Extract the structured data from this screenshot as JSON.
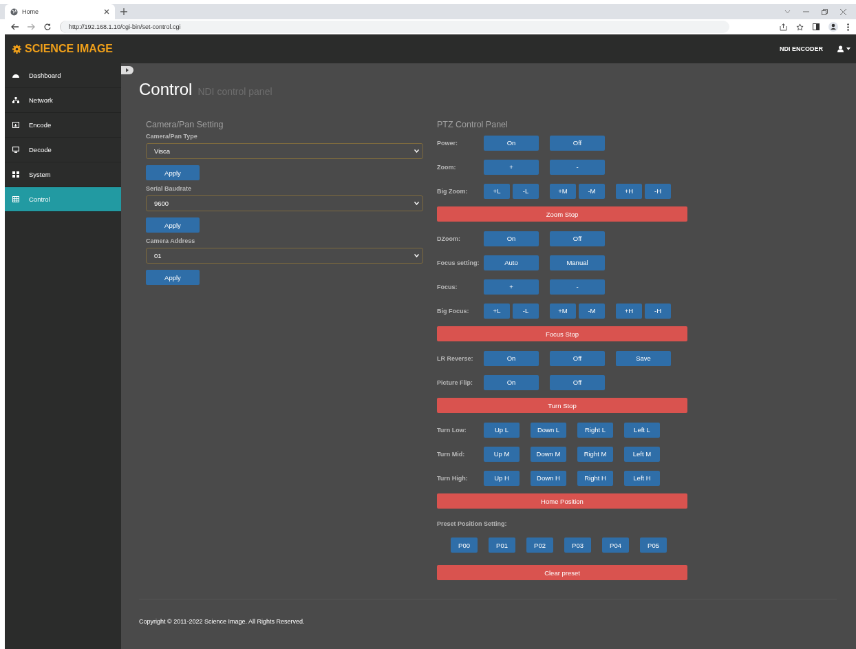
{
  "browser": {
    "tab_title": "Home",
    "url": "http://192.168.1.10/cgi-bin/set-control.cgi"
  },
  "header": {
    "brand": "SCIENCE IMAGE",
    "device": "NDI ENCODER"
  },
  "sidebar": {
    "items": [
      {
        "label": "Dashboard",
        "selected": false
      },
      {
        "label": "Network",
        "selected": false
      },
      {
        "label": "Encode",
        "selected": false
      },
      {
        "label": "Decode",
        "selected": false
      },
      {
        "label": "System",
        "selected": false
      },
      {
        "label": "Control",
        "selected": true
      }
    ]
  },
  "page": {
    "title": "Control",
    "subtitle": "NDI control panel"
  },
  "camera_settings": {
    "heading": "Camera/Pan Setting",
    "fields": [
      {
        "label": "Camera/Pan Type",
        "value": "Visca",
        "button": "Apply"
      },
      {
        "label": "Serial Baudrate",
        "value": "9600",
        "button": "Apply"
      },
      {
        "label": "Camera Address",
        "value": "01",
        "button": "Apply"
      }
    ]
  },
  "ptz": {
    "heading": "PTZ Control Panel",
    "rows": [
      {
        "kind": "row",
        "label": "Power:",
        "groups": [
          [
            "On"
          ],
          [
            "Off"
          ]
        ]
      },
      {
        "kind": "row",
        "label": "Zoom:",
        "groups": [
          [
            "+"
          ],
          [
            "-"
          ]
        ]
      },
      {
        "kind": "row",
        "label": "Big Zoom:",
        "groups": [
          [
            "+L",
            "-L"
          ],
          [
            "+M",
            "-M"
          ],
          [
            "+H",
            "-H"
          ]
        ]
      },
      {
        "kind": "stop",
        "label": "Zoom Stop"
      },
      {
        "kind": "row",
        "label": "DZoom:",
        "groups": [
          [
            "On"
          ],
          [
            "Off"
          ]
        ]
      },
      {
        "kind": "row",
        "label": "Focus setting:",
        "groups": [
          [
            "Auto"
          ],
          [
            "Manual"
          ]
        ]
      },
      {
        "kind": "row",
        "label": "Focus:",
        "groups": [
          [
            "+"
          ],
          [
            "-"
          ]
        ]
      },
      {
        "kind": "row",
        "label": "Big Focus:",
        "groups": [
          [
            "+L",
            "-L"
          ],
          [
            "+M",
            "-M"
          ],
          [
            "+H",
            "-H"
          ]
        ]
      },
      {
        "kind": "stop",
        "label": "Focus Stop"
      },
      {
        "kind": "row",
        "label": "LR Reverse:",
        "groups": [
          [
            "On"
          ],
          [
            "Off"
          ],
          [
            "Save"
          ]
        ]
      },
      {
        "kind": "row",
        "label": "Picture Flip:",
        "groups": [
          [
            "On"
          ],
          [
            "Off"
          ]
        ]
      },
      {
        "kind": "stop",
        "label": "Turn Stop"
      },
      {
        "kind": "turn",
        "label": "Turn Low:",
        "buttons": [
          "Up L",
          "Down L",
          "Right L",
          "Left L"
        ]
      },
      {
        "kind": "turn",
        "label": "Turn Mid:",
        "buttons": [
          "Up M",
          "Down M",
          "Right M",
          "Left M"
        ]
      },
      {
        "kind": "turn",
        "label": "Turn High:",
        "buttons": [
          "Up H",
          "Down H",
          "Right H",
          "Left H"
        ]
      },
      {
        "kind": "stop",
        "label": "Home Position"
      },
      {
        "kind": "caption",
        "label": "Preset Position Setting:"
      },
      {
        "kind": "presets",
        "buttons": [
          "P00",
          "P01",
          "P02",
          "P03",
          "P04",
          "P05"
        ]
      },
      {
        "kind": "stop",
        "label": "Clear preset"
      }
    ]
  },
  "footer": "Copyright © 2011-2022 Science Image. All Rights Reserved."
}
